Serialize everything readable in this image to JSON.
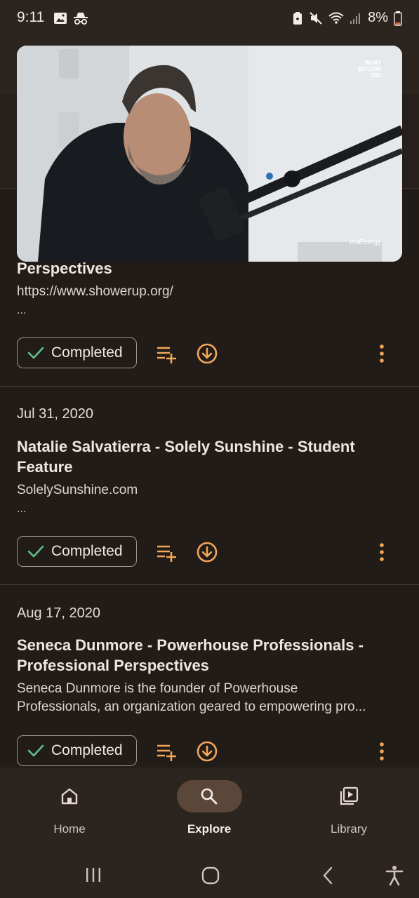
{
  "status_bar": {
    "time": "9:11",
    "battery": "8%",
    "icons": [
      "image-icon",
      "incognito-icon",
      "battery-saver-icon",
      "mute-icon",
      "wifi-icon",
      "signal-icon",
      "battery-icon"
    ]
  },
  "video": {
    "watermark_top": "WHAT BITCOIN DID",
    "watermark_bottom": "IrisEnergy"
  },
  "episodes": [
    {
      "title": "Perspectives",
      "description": "https://www.showerup.org/",
      "ellipsis": "...",
      "status": "Completed"
    },
    {
      "date": "Jul 31, 2020",
      "title": "Natalie Salvatierra - Solely Sunshine - Student Feature",
      "description": "SolelySunshine.com",
      "ellipsis": "...",
      "status": "Completed"
    },
    {
      "date": "Aug 17, 2020",
      "title": "Seneca Dunmore - Powerhouse Professionals - Professional Perspectives",
      "description_line1": "Seneca Dunmore is the founder of Powerhouse",
      "description_line2": "Professionals, an organization geared to empowering pro...",
      "status": "Completed"
    }
  ],
  "bottom_nav": {
    "items": [
      {
        "label": "Home",
        "icon": "home-icon"
      },
      {
        "label": "Explore",
        "icon": "search-icon",
        "active": true
      },
      {
        "label": "Library",
        "icon": "library-icon"
      }
    ]
  },
  "colors": {
    "accent": "#f2a65a",
    "check": "#5fc08a",
    "background": "#221c18"
  }
}
